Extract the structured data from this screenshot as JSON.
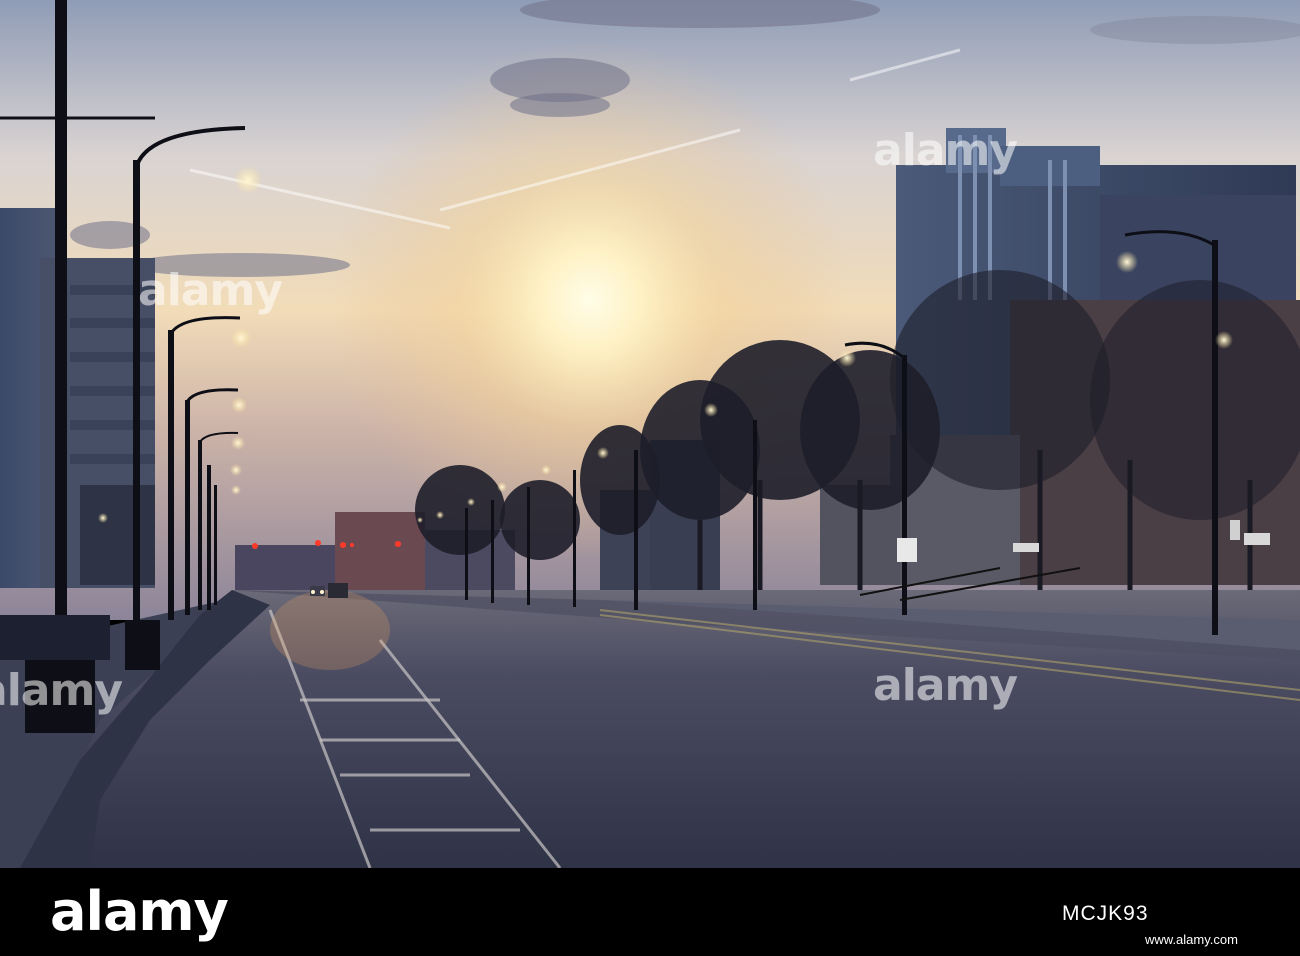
{
  "photo": {
    "colors": {
      "sky_top": "#9aa6bb",
      "sky_glow": "#fff3c8",
      "road": "#3d4054",
      "buildings": "#2a2f44"
    }
  },
  "watermark": {
    "text": "alamy"
  },
  "footer": {
    "logo": "alamy",
    "image_id": "MCJK93",
    "site": "www.alamy.com"
  }
}
